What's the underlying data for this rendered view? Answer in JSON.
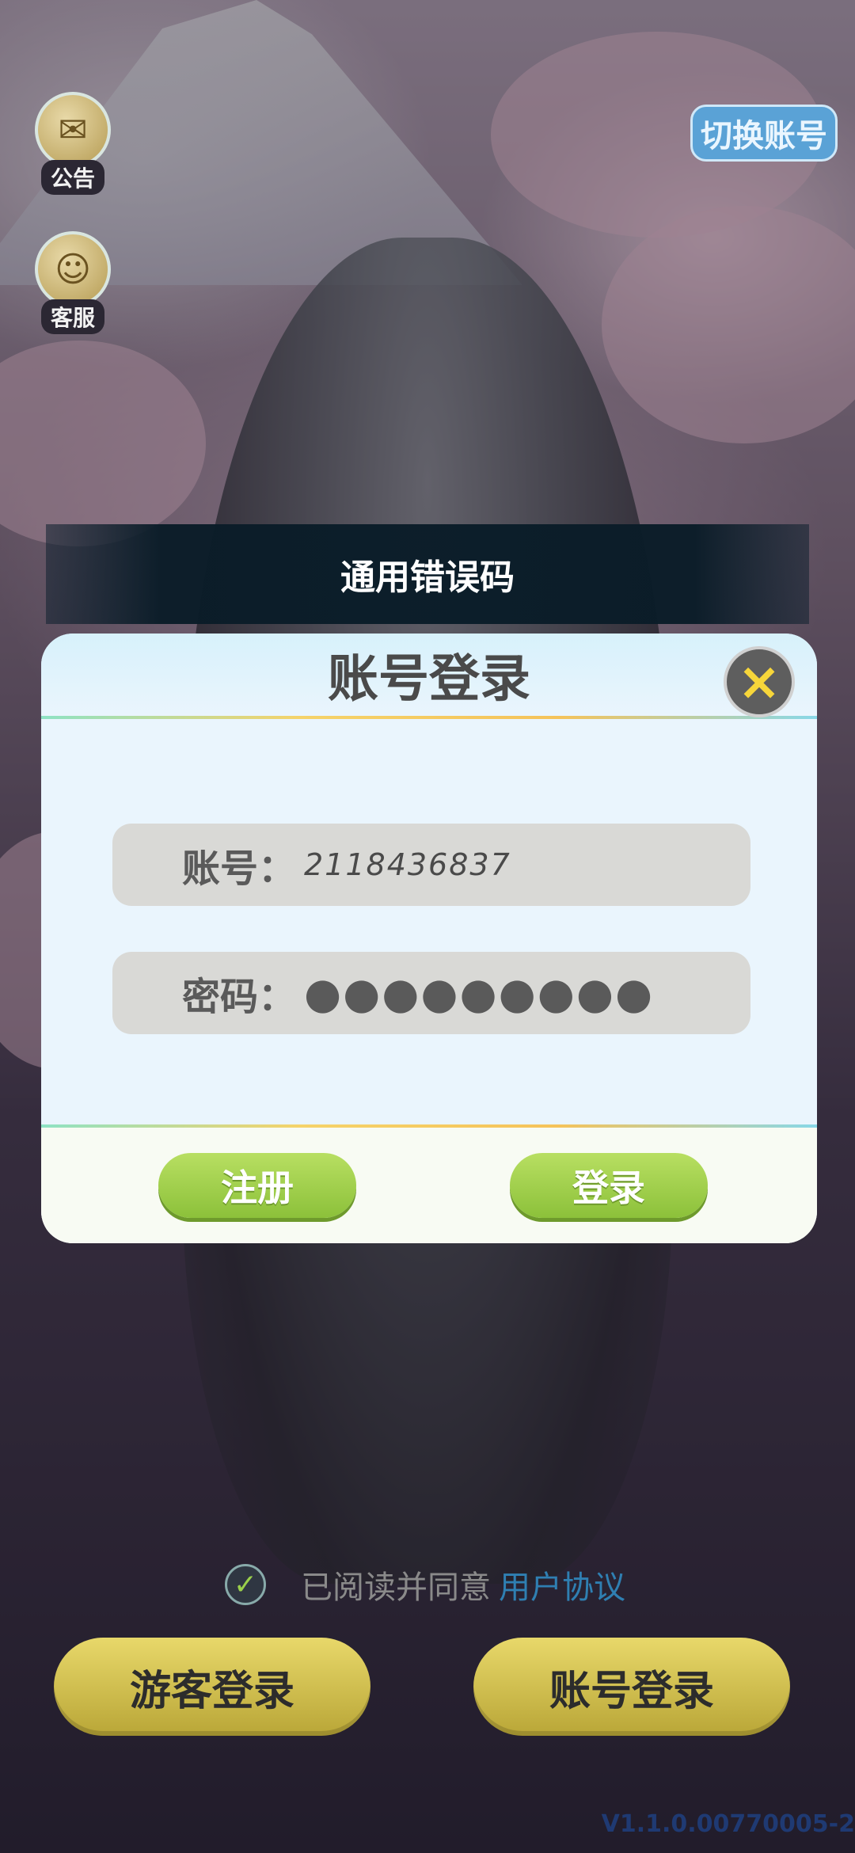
{
  "side_buttons": {
    "notice_label": "公告",
    "service_label": "客服"
  },
  "switch_account_label": "切换账号",
  "error_banner": "通用错误码",
  "login_dialog": {
    "title": "账号登录",
    "close_icon": "×",
    "account_label": "账号：",
    "account_value": "2118436837",
    "password_label": "密码：",
    "password_value": "●●●●●●●●●",
    "register_label": "注册",
    "login_label": "登录"
  },
  "agreement": {
    "checked": true,
    "text": "已阅读并同意",
    "link": "用户协议"
  },
  "bottom_buttons": {
    "guest_login": "游客登录",
    "account_login": "账号登录"
  },
  "version": "V1.1.0.00770005-2",
  "icons": [
    "notice-icon",
    "service-icon",
    "close-icon",
    "check-icon"
  ],
  "colors": {
    "accent_green": "#9ad04b",
    "link_blue": "#2f7fb2",
    "close_yellow": "#f7d63a"
  }
}
